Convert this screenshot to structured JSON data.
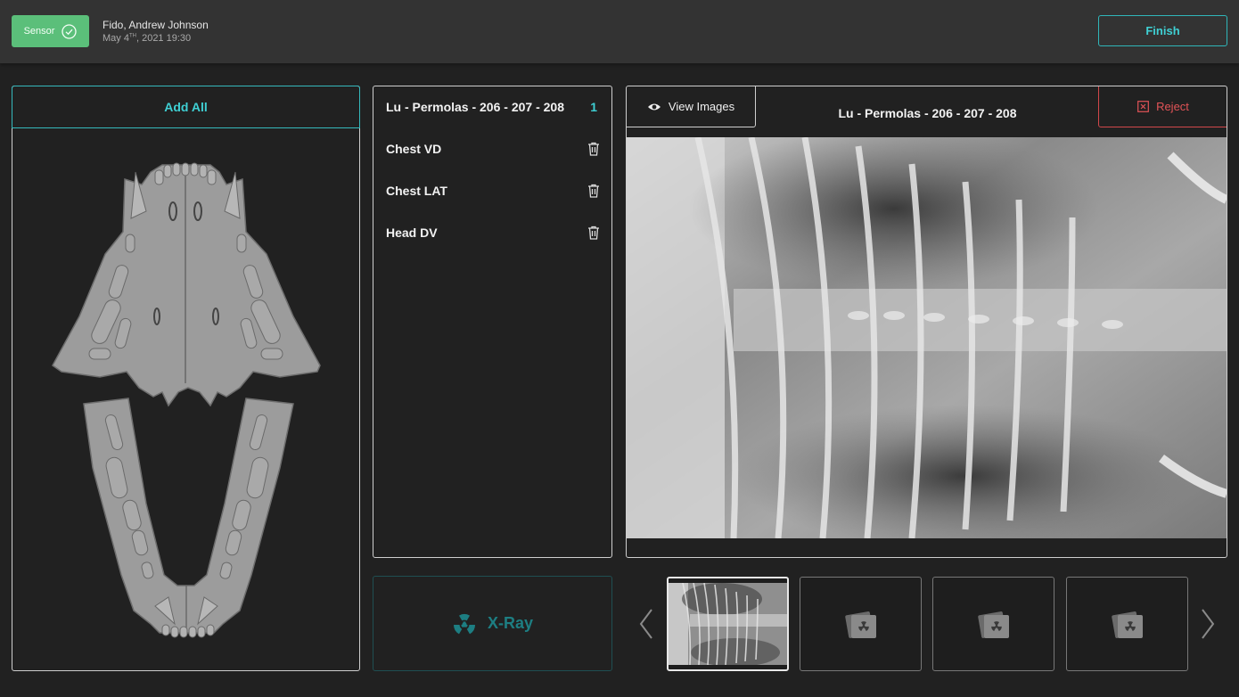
{
  "header": {
    "sensor_label": "Sensor",
    "patient_name": "Fido, Andrew Johnson",
    "date_main": "May 4",
    "date_suffix": "TH",
    "date_rest": ", 2021  19:30",
    "finish_label": "Finish"
  },
  "left_panel": {
    "add_all_label": "Add All"
  },
  "study_list": {
    "items": [
      {
        "label": "Lu - Permolas - 206 - 207 - 208",
        "count": "1"
      },
      {
        "label": "Chest VD"
      },
      {
        "label": "Chest LAT"
      },
      {
        "label": "Head DV"
      }
    ]
  },
  "xray_button": {
    "label": "X-Ray"
  },
  "viewer": {
    "view_images_label": "View Images",
    "title": "Lu - Permolas - 206 - 207 - 208",
    "reject_label": "Reject"
  },
  "thumbnails": {
    "items": [
      {
        "state": "captured",
        "active": true
      },
      {
        "state": "empty"
      },
      {
        "state": "empty"
      },
      {
        "state": "empty"
      }
    ]
  },
  "colors": {
    "accent": "#3fd0d4",
    "sensor_ok": "#5bbf7a",
    "reject": "#e25357",
    "background": "#212121"
  },
  "icons": [
    "check-circle-icon",
    "eye-icon",
    "close-box-icon",
    "trash-icon",
    "radiation-icon",
    "chevron-left-icon",
    "chevron-right-icon",
    "xray-placeholder-icon"
  ]
}
